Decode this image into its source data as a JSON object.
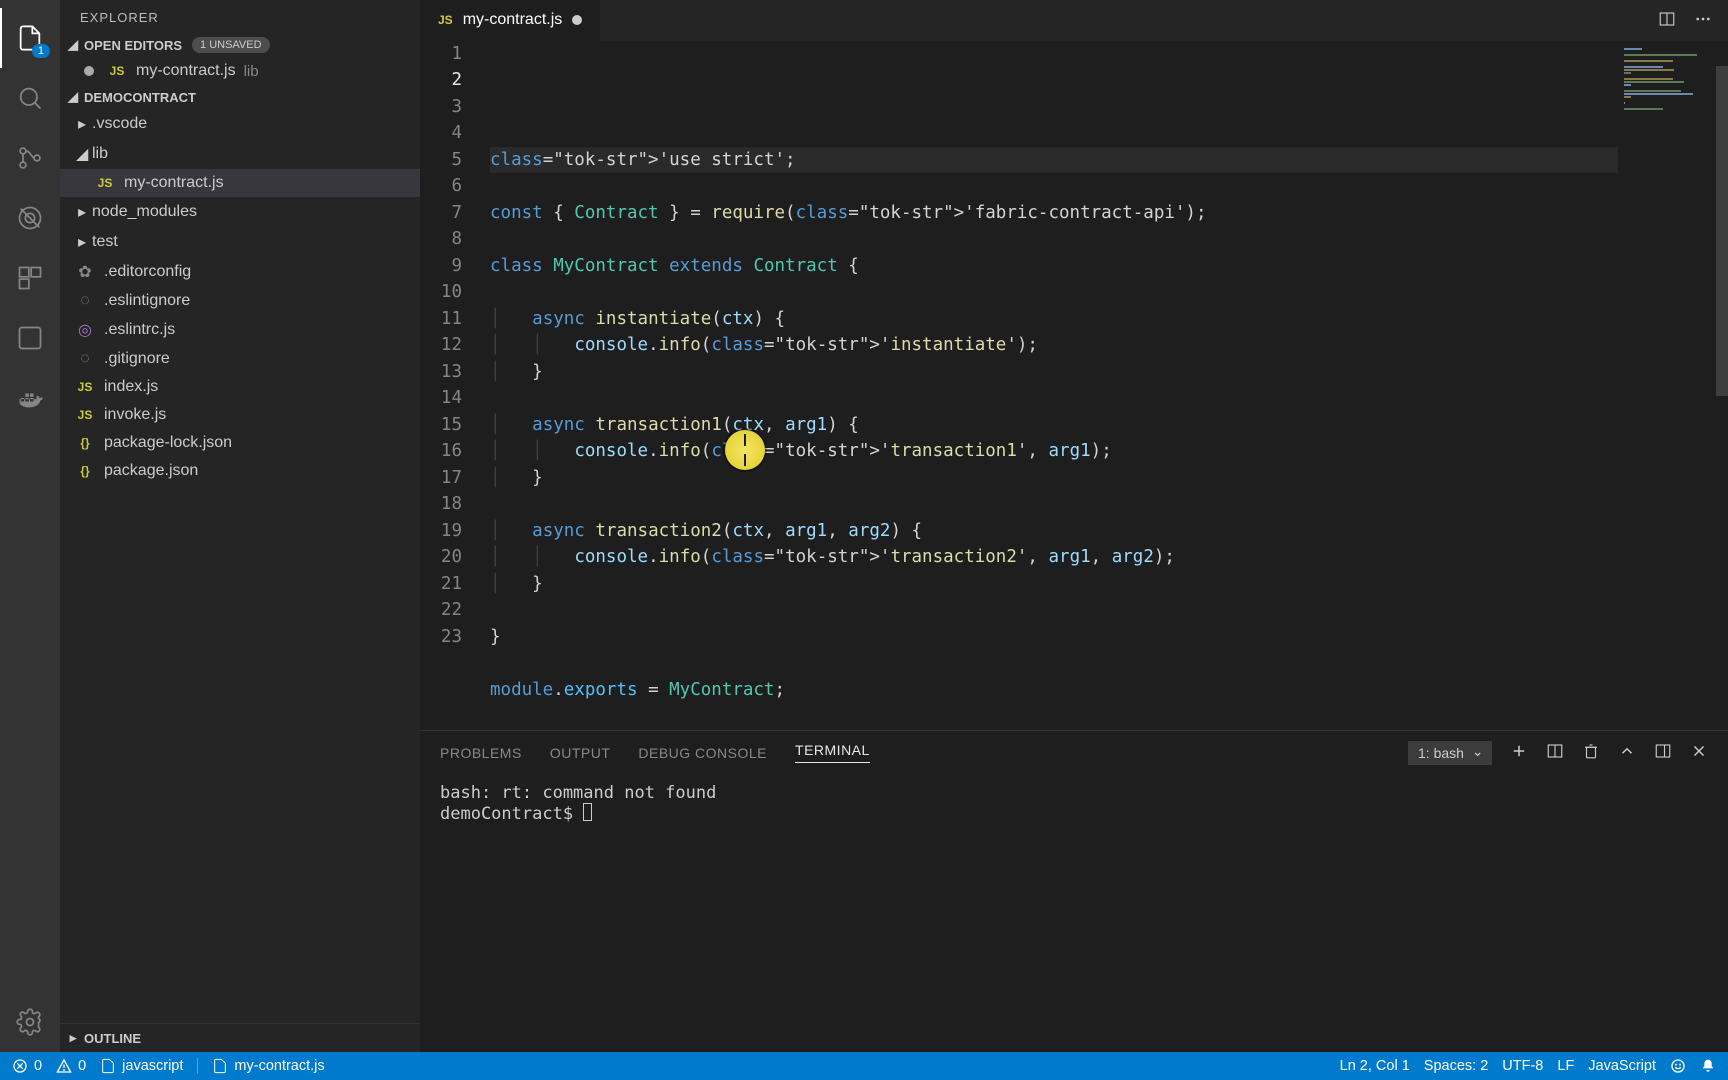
{
  "sidebar": {
    "title": "EXPLORER",
    "openEditors": {
      "label": "OPEN EDITORS",
      "badge": "1 UNSAVED",
      "items": [
        {
          "name": "my-contract.js",
          "dir": "lib",
          "unsaved": true
        }
      ]
    },
    "project": {
      "name": "DEMOCONTRACT",
      "tree": [
        {
          "type": "folder",
          "name": ".vscode",
          "open": false,
          "depth": 0
        },
        {
          "type": "folder",
          "name": "lib",
          "open": true,
          "depth": 0
        },
        {
          "type": "file",
          "name": "my-contract.js",
          "icon": "js",
          "depth": 1,
          "active": true
        },
        {
          "type": "folder",
          "name": "node_modules",
          "open": false,
          "depth": 0
        },
        {
          "type": "folder",
          "name": "test",
          "open": false,
          "depth": 0
        },
        {
          "type": "file",
          "name": ".editorconfig",
          "icon": "gear",
          "depth": 0
        },
        {
          "type": "file",
          "name": ".eslintignore",
          "icon": "dot",
          "depth": 0
        },
        {
          "type": "file",
          "name": ".eslintrc.js",
          "icon": "target",
          "depth": 0
        },
        {
          "type": "file",
          "name": ".gitignore",
          "icon": "dot",
          "depth": 0
        },
        {
          "type": "file",
          "name": "index.js",
          "icon": "js",
          "depth": 0
        },
        {
          "type": "file",
          "name": "invoke.js",
          "icon": "js",
          "depth": 0
        },
        {
          "type": "file",
          "name": "package-lock.json",
          "icon": "json",
          "depth": 0
        },
        {
          "type": "file",
          "name": "package.json",
          "icon": "json",
          "depth": 0
        }
      ]
    },
    "outline": "OUTLINE"
  },
  "activity": {
    "badge": "1"
  },
  "tab": {
    "filename": "my-contract.js",
    "unsaved": true
  },
  "code": {
    "lines_total": 23,
    "highlight_line": 2,
    "lines": [
      "",
      "'use strict';",
      "",
      "const { Contract } = require('fabric-contract-api');",
      "",
      "class MyContract extends Contract {",
      "",
      "    async instantiate(ctx) {",
      "        console.info('instantiate');",
      "    }",
      "",
      "    async transaction1(ctx, arg1) {",
      "        console.info('transaction1', arg1);",
      "    }",
      "",
      "    async transaction2(ctx, arg1, arg2) {",
      "        console.info('transaction2', arg1, arg2);",
      "    }",
      "",
      "}",
      "",
      "module.exports = MyContract;",
      ""
    ]
  },
  "panel": {
    "tabs": [
      "PROBLEMS",
      "OUTPUT",
      "DEBUG CONSOLE",
      "TERMINAL"
    ],
    "active": "TERMINAL",
    "terminal_select": "1: bash",
    "terminal_lines": [
      "bash: rt: command not found",
      "demoContract$ "
    ]
  },
  "status": {
    "errors": "0",
    "warnings": "0",
    "lang_lint": "javascript",
    "file": "my-contract.js",
    "cursor": "Ln 2, Col 1",
    "spaces": "Spaces: 2",
    "encoding": "UTF-8",
    "eol": "LF",
    "language": "JavaScript"
  }
}
